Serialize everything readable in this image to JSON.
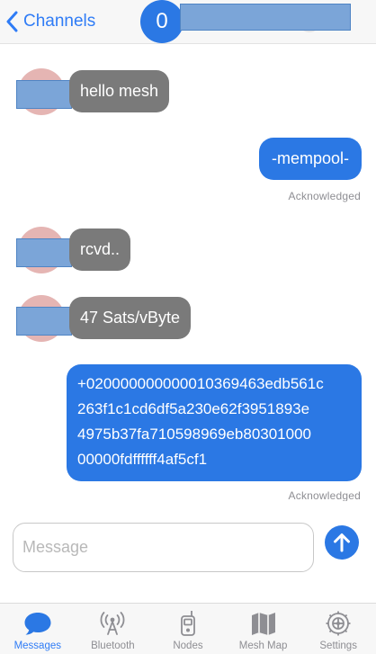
{
  "navbar": {
    "back_label": "Channels",
    "channel_index": "0"
  },
  "messages": [
    {
      "direction": "incoming",
      "text": "hello mesh",
      "status": ""
    },
    {
      "direction": "outgoing",
      "text": "-mempool-",
      "status": "Acknowledged"
    },
    {
      "direction": "incoming",
      "text": "rcvd..",
      "status": ""
    },
    {
      "direction": "incoming",
      "text": "47 Sats/vByte",
      "status": ""
    },
    {
      "direction": "outgoing",
      "text": "+020000000000010369463edb561c\n263f1c1cd6df5a230e62f3951893e\n4975b37fa710598969eb80301000\n00000fdffffff4af5cf1",
      "status": "Acknowledged"
    }
  ],
  "composer": {
    "placeholder": "Message",
    "value": ""
  },
  "tabs": [
    {
      "label": "Messages",
      "icon": "message-bubble-icon",
      "active": true
    },
    {
      "label": "Bluetooth",
      "icon": "antenna-icon",
      "active": false
    },
    {
      "label": "Nodes",
      "icon": "radio-device-icon",
      "active": false
    },
    {
      "label": "Mesh Map",
      "icon": "map-icon",
      "active": false
    },
    {
      "label": "Settings",
      "icon": "gear-icon",
      "active": false
    }
  ],
  "colors": {
    "accent": "#2b78e4",
    "incoming_bubble": "#7a7a7a",
    "avatar": "#e5b5b3",
    "redaction": "#7ba5d8"
  }
}
